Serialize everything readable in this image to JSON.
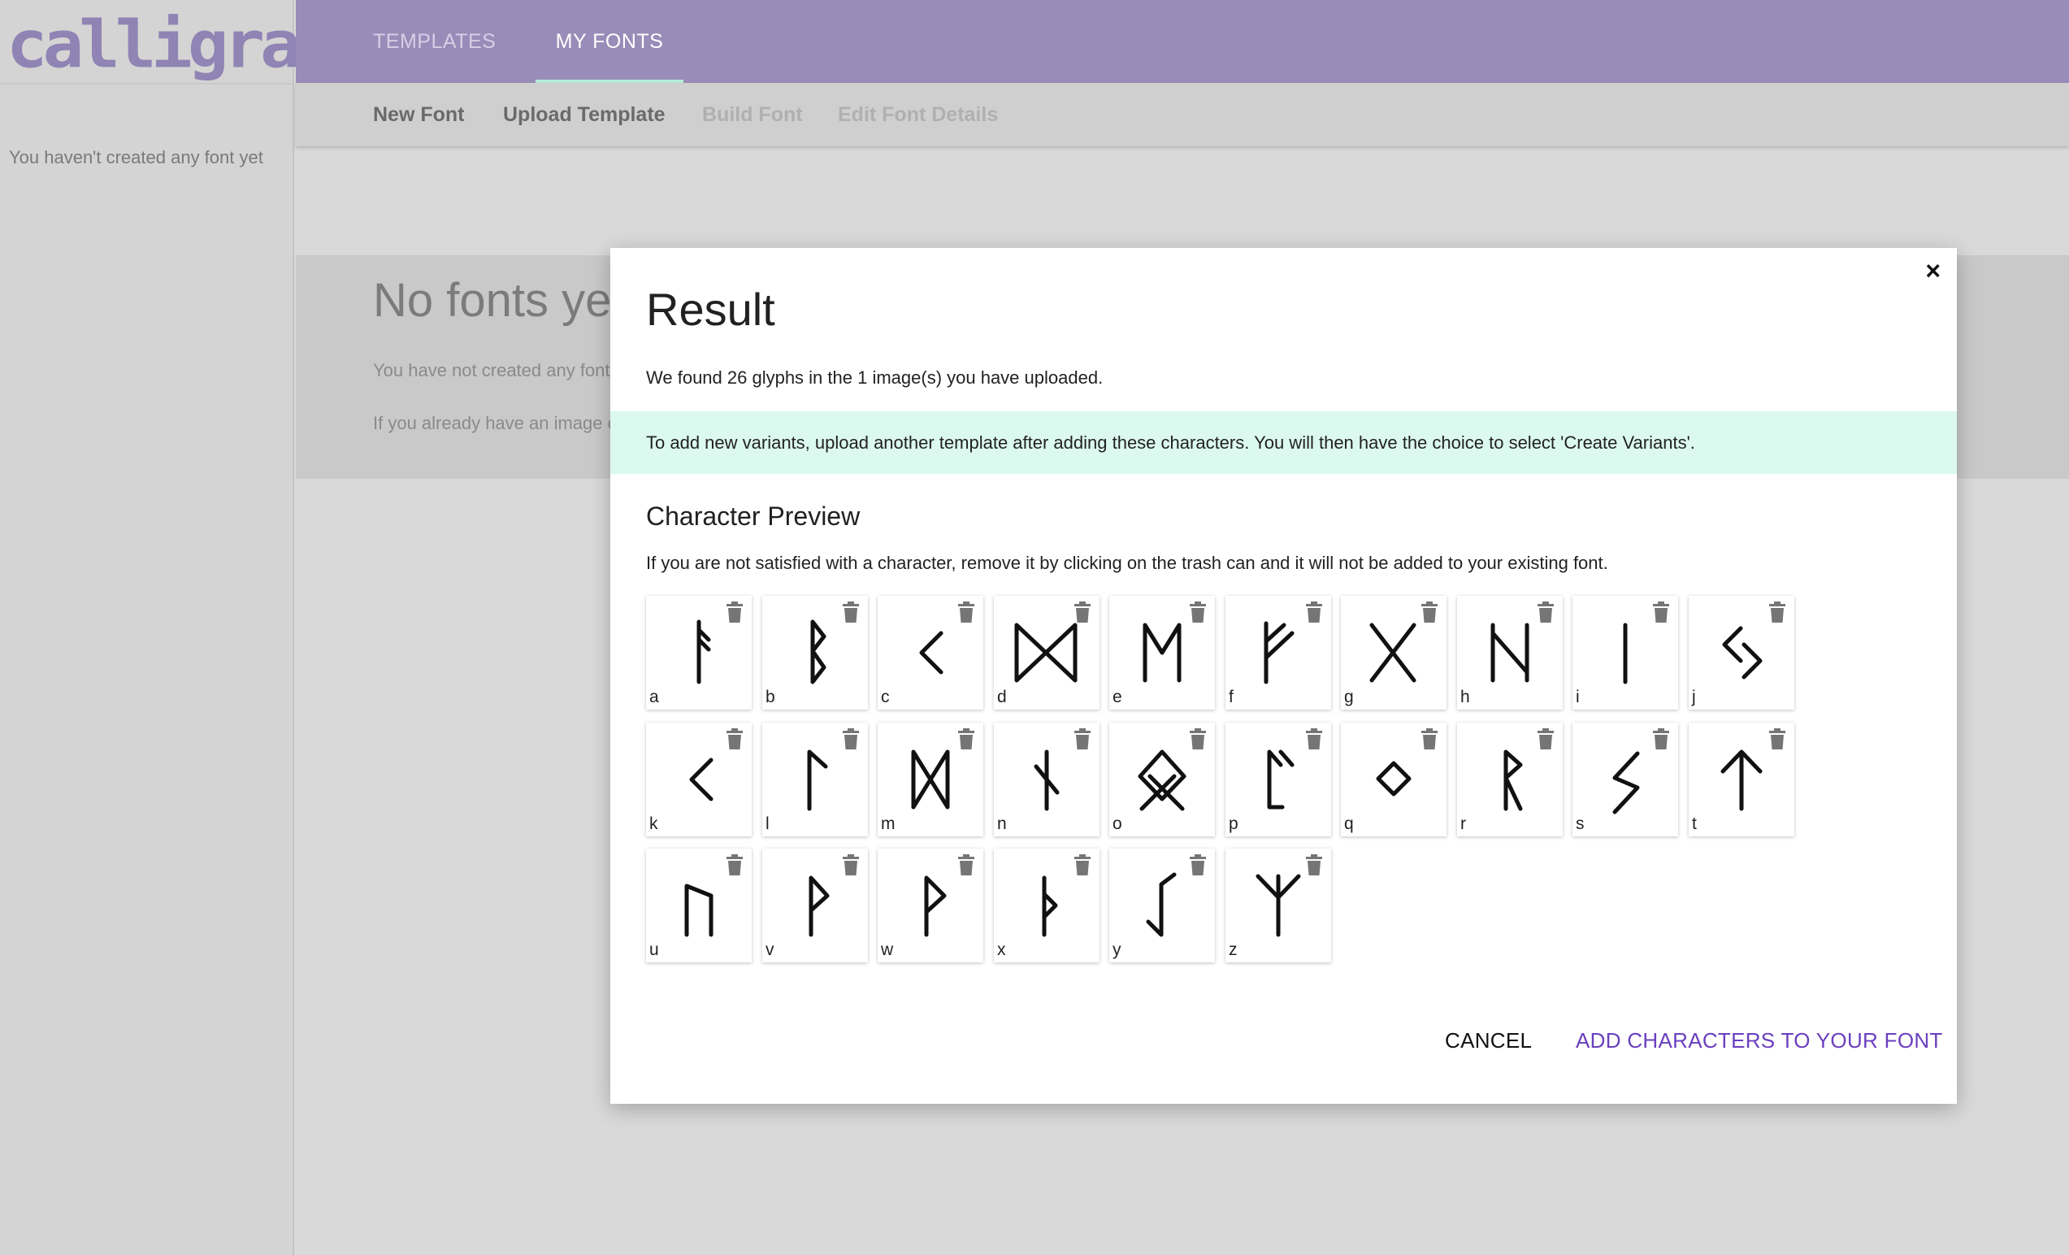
{
  "app": {
    "logo_text": "calligraphr"
  },
  "sidebar": {
    "empty_text": "You haven't created any font yet"
  },
  "topnav": {
    "tabs": [
      {
        "label": "TEMPLATES"
      },
      {
        "label": "MY FONTS"
      }
    ]
  },
  "steps": [
    {
      "label": "New Font"
    },
    {
      "label": "Upload Template"
    },
    {
      "label": "Build Font"
    },
    {
      "label": "Edit Font Details"
    }
  ],
  "hero": {
    "title": "No fonts yet",
    "line1": "You have not created any font",
    "line2": "If you already have an image o"
  },
  "modal": {
    "close_glyph": "×",
    "title": "Result",
    "found_text": "We found 26 glyphs in the 1 image(s) you have uploaded.",
    "info_text": "To add new variants, upload another template after adding these characters. You will then have the choice to select 'Create Variants'.",
    "preview_heading": "Character Preview",
    "preview_help": "If you are not satisfied with a character, remove it by clicking on the trash can and it will not be added to your existing font.",
    "glyphs": [
      {
        "label": "a"
      },
      {
        "label": "b"
      },
      {
        "label": "c"
      },
      {
        "label": "d"
      },
      {
        "label": "e"
      },
      {
        "label": "f"
      },
      {
        "label": "g"
      },
      {
        "label": "h"
      },
      {
        "label": "i"
      },
      {
        "label": "j"
      },
      {
        "label": "k"
      },
      {
        "label": "l"
      },
      {
        "label": "m"
      },
      {
        "label": "n"
      },
      {
        "label": "o"
      },
      {
        "label": "p"
      },
      {
        "label": "q"
      },
      {
        "label": "r"
      },
      {
        "label": "s"
      },
      {
        "label": "t"
      },
      {
        "label": "u"
      },
      {
        "label": "v"
      },
      {
        "label": "w"
      },
      {
        "label": "x"
      },
      {
        "label": "y"
      },
      {
        "label": "z"
      }
    ],
    "cancel_label": "CANCEL",
    "add_label": "ADD CHARACTERS TO YOUR FONT"
  },
  "colors": {
    "topbar": "#998cb8",
    "accent_link": "#6a3fbf",
    "info_band": "#dbf9ee",
    "tab_indicator": "#b8ecd8"
  }
}
